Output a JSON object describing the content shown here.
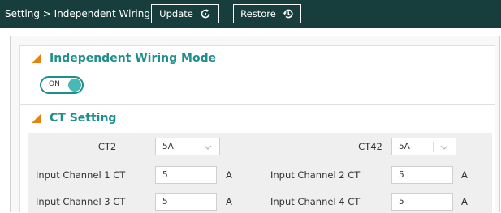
{
  "header": {
    "breadcrumb": "Setting > Independent Wiring",
    "update_label": "Update",
    "restore_label": "Restore"
  },
  "mode_section": {
    "title": "Independent Wiring Mode",
    "toggle_label": "ON",
    "toggle_state": "on"
  },
  "ct_section": {
    "title": "CT Setting",
    "selects": [
      {
        "label": "CT2",
        "value": "5A"
      },
      {
        "label": "CT42",
        "value": "5A"
      }
    ],
    "channels": [
      {
        "label": "Input Channel 1 CT",
        "value": "5",
        "unit": "A"
      },
      {
        "label": "Input Channel 2 CT",
        "value": "5",
        "unit": "A"
      },
      {
        "label": "Input Channel 3 CT",
        "value": "5",
        "unit": "A"
      },
      {
        "label": "Input Channel 4 CT",
        "value": "5",
        "unit": "A"
      }
    ]
  },
  "colors": {
    "header_bg": "#183d3d",
    "accent_teal": "#1e8f8c",
    "section_marker": "#e8820c"
  }
}
